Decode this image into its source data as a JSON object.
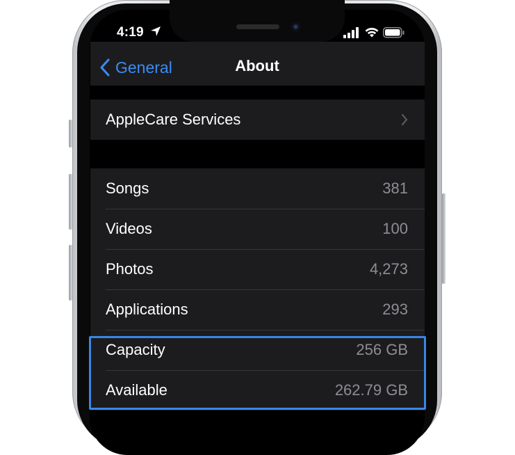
{
  "status_bar": {
    "time": "4:19"
  },
  "nav": {
    "back_label": "General",
    "title": "About"
  },
  "top_group": {
    "items": [
      {
        "label": "AppleCare Services"
      }
    ]
  },
  "info_group": {
    "items": [
      {
        "label": "Songs",
        "value": "381"
      },
      {
        "label": "Videos",
        "value": "100"
      },
      {
        "label": "Photos",
        "value": "4,273"
      },
      {
        "label": "Applications",
        "value": "293"
      },
      {
        "label": "Capacity",
        "value": "256 GB"
      },
      {
        "label": "Available",
        "value": "262.79 GB"
      }
    ]
  },
  "colors": {
    "accent": "#3b8cf5",
    "highlight_border": "#3a86e6",
    "group_background": "#1c1c1e",
    "screen_background": "#000000"
  },
  "icons": {
    "location": "location-arrow-icon",
    "signal": "cellular-signal-icon",
    "wifi": "wifi-icon",
    "battery": "battery-icon",
    "back": "chevron-left-icon",
    "disclosure": "chevron-right-icon"
  }
}
